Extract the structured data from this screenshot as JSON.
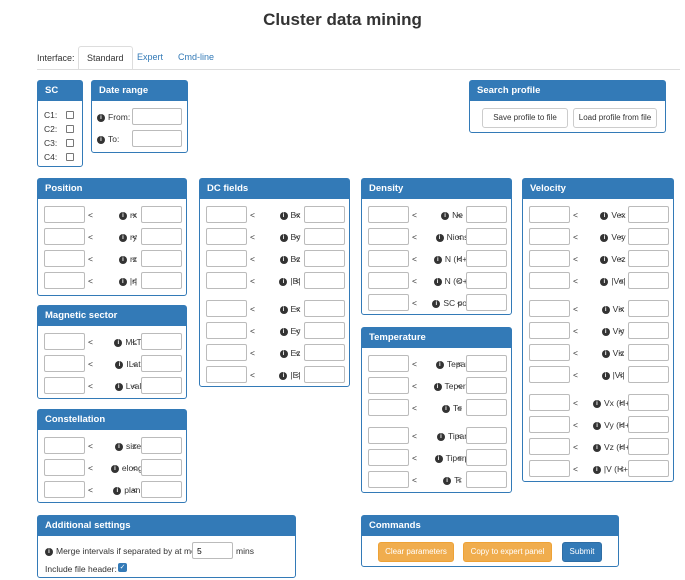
{
  "app_title": "Cluster data mining",
  "interface": {
    "label": "Interface:",
    "tabs": [
      "Standard",
      "Expert",
      "Cmd-line"
    ],
    "active_tab": "Standard"
  },
  "sc": {
    "title": "SC",
    "items": [
      "C1:",
      "C2:",
      "C3:",
      "C4:"
    ]
  },
  "date_range": {
    "title": "Date range",
    "from_label": "From:",
    "to_label": "To:"
  },
  "search_profile": {
    "title": "Search profile",
    "save_label": "Save profile to file",
    "load_label": "Load profile from file"
  },
  "position": {
    "title": "Position",
    "rows": [
      "rx",
      "ry",
      "rz",
      "|r|"
    ]
  },
  "magnetic_sector": {
    "title": "Magnetic sector",
    "rows": [
      "MLT",
      "ILat",
      "Lval"
    ]
  },
  "constellation": {
    "title": "Constellation",
    "rows": [
      "size",
      "elong.",
      "plan."
    ]
  },
  "dc_fields": {
    "title": "DC fields",
    "rows": [
      "Bx",
      "By",
      "Bz",
      "|B|",
      "Ex",
      "Ey",
      "Ez",
      "|E|"
    ]
  },
  "density": {
    "title": "Density",
    "rows": [
      "Ne",
      "Nions",
      "N (H+)",
      "N (O+)",
      "SC pot."
    ]
  },
  "temperature": {
    "title": "Temperature",
    "rows": [
      "Tepar",
      "Teperp",
      "Te",
      "Tipar",
      "Tiperp",
      "Ti"
    ]
  },
  "velocity": {
    "title": "Velocity",
    "rows": [
      "Vex",
      "Vey",
      "Vez",
      "|Ve|",
      "Vix",
      "Viy",
      "Viz",
      "|Vi|",
      "Vx (H+)",
      "Vy (H+)",
      "Vz (H+)",
      "|V (H+)|"
    ]
  },
  "additional_settings": {
    "title": "Additional settings",
    "merge_label": "Merge intervals if separated by at most",
    "merge_value": "5",
    "merge_unit": "mins",
    "header_label": "Include file header:",
    "header_checked": true
  },
  "commands": {
    "title": "Commands",
    "clear_label": "Clear parameters",
    "copy_label": "Copy to expert panel",
    "submit_label": "Submit"
  },
  "symbols": {
    "lt": "<"
  }
}
